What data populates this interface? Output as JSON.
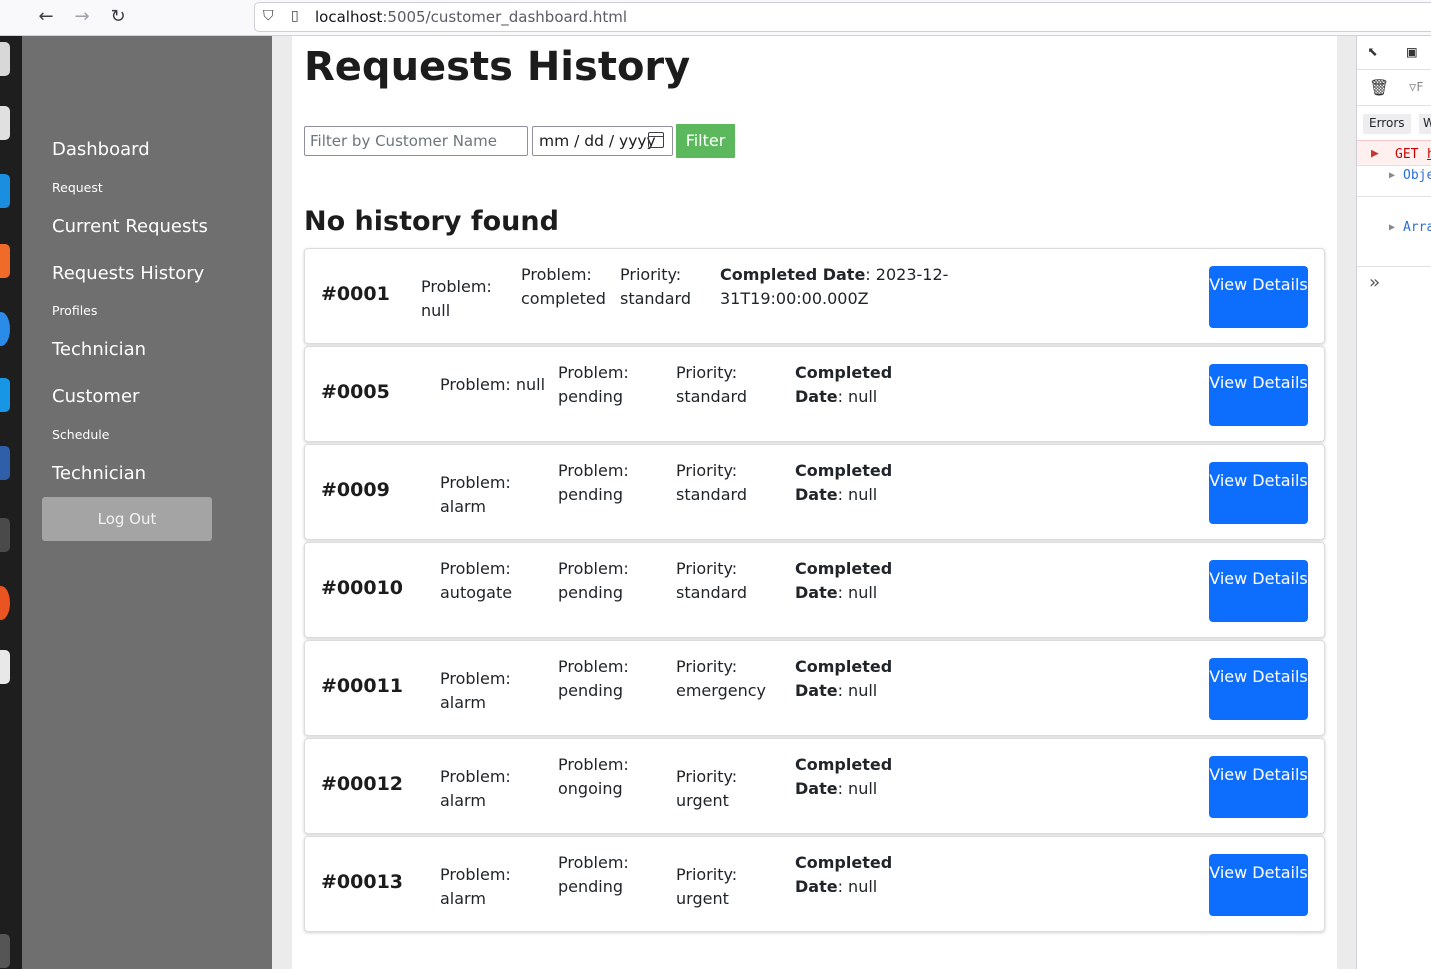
{
  "browser": {
    "url_host": "localhost",
    "url_path": ":5005/customer_dashboard.html",
    "back_icon": "arrow-left-icon",
    "forward_icon": "arrow-right-icon",
    "reload_icon": "reload-icon"
  },
  "sidebar": {
    "dashboard": "Dashboard",
    "request_head": "Request",
    "current_requests": "Current Requests",
    "requests_history": "Requests History",
    "profiles_head": "Profiles",
    "technician_profile": "Technician",
    "customer_profile": "Customer",
    "schedule_head": "Schedule",
    "technician_schedule": "Technician",
    "logout": "Log Out"
  },
  "main": {
    "title": "Requests History",
    "filter_placeholder": "Filter by Customer Name",
    "date_placeholder": "mm / dd / yyyy",
    "filter_button": "Filter",
    "no_history": "No history found",
    "view_details": "View Details"
  },
  "requests": [
    {
      "id": "#0001",
      "problem_type": "Problem: null",
      "problem_status": "Problem: completed",
      "priority": "Priority: standard",
      "completed_label": "Completed Date",
      "completed_value": ": 2023-12-31T19:00:00.000Z"
    },
    {
      "id": "#0005",
      "problem_type": "Problem: null",
      "problem_status": "Problem: pending",
      "priority": "Priority: standard",
      "completed_label": "Completed Date",
      "completed_value": ": null"
    },
    {
      "id": "#0009",
      "problem_type": "Problem: alarm",
      "problem_status": "Problem: pending",
      "priority": "Priority: standard",
      "completed_label": "Completed Date",
      "completed_value": ": null"
    },
    {
      "id": "#00010",
      "problem_type": "Problem: autogate",
      "problem_status": "Problem: pending",
      "priority": "Priority: standard",
      "completed_label": "Completed Date",
      "completed_value": ": null"
    },
    {
      "id": "#00011",
      "problem_type": "Problem: alarm",
      "problem_status": "Problem: pending",
      "priority": "Priority: emergency",
      "completed_label": "Completed Date",
      "completed_value": ": null"
    },
    {
      "id": "#00012",
      "problem_type": "Problem: alarm",
      "problem_status": "Problem: ongoing",
      "priority": "Priority: urgent",
      "completed_label": "Completed Date",
      "completed_value": ": null"
    },
    {
      "id": "#00013",
      "problem_type": "Problem: alarm",
      "problem_status": "Problem: pending",
      "priority": "Priority: urgent",
      "completed_label": "Completed Date",
      "completed_value": ": null"
    }
  ],
  "devtools": {
    "errors_tab": "Errors",
    "w_tab": "W",
    "get_label": "GET",
    "get_url": "h",
    "object_label": "Obje",
    "array_label": "Arra",
    "pick_icon": "element-picker-icon",
    "responsive_icon": "responsive-mode-icon",
    "trash_icon": "trash-icon",
    "filter_icon": "filter-icon",
    "expand_icon": "double-chevron-icon"
  },
  "colors": {
    "sidebar": "#6f6f6f",
    "filter_button": "#5cb85c",
    "view_button": "#0d6efd",
    "logout": "#a4a4a4"
  }
}
